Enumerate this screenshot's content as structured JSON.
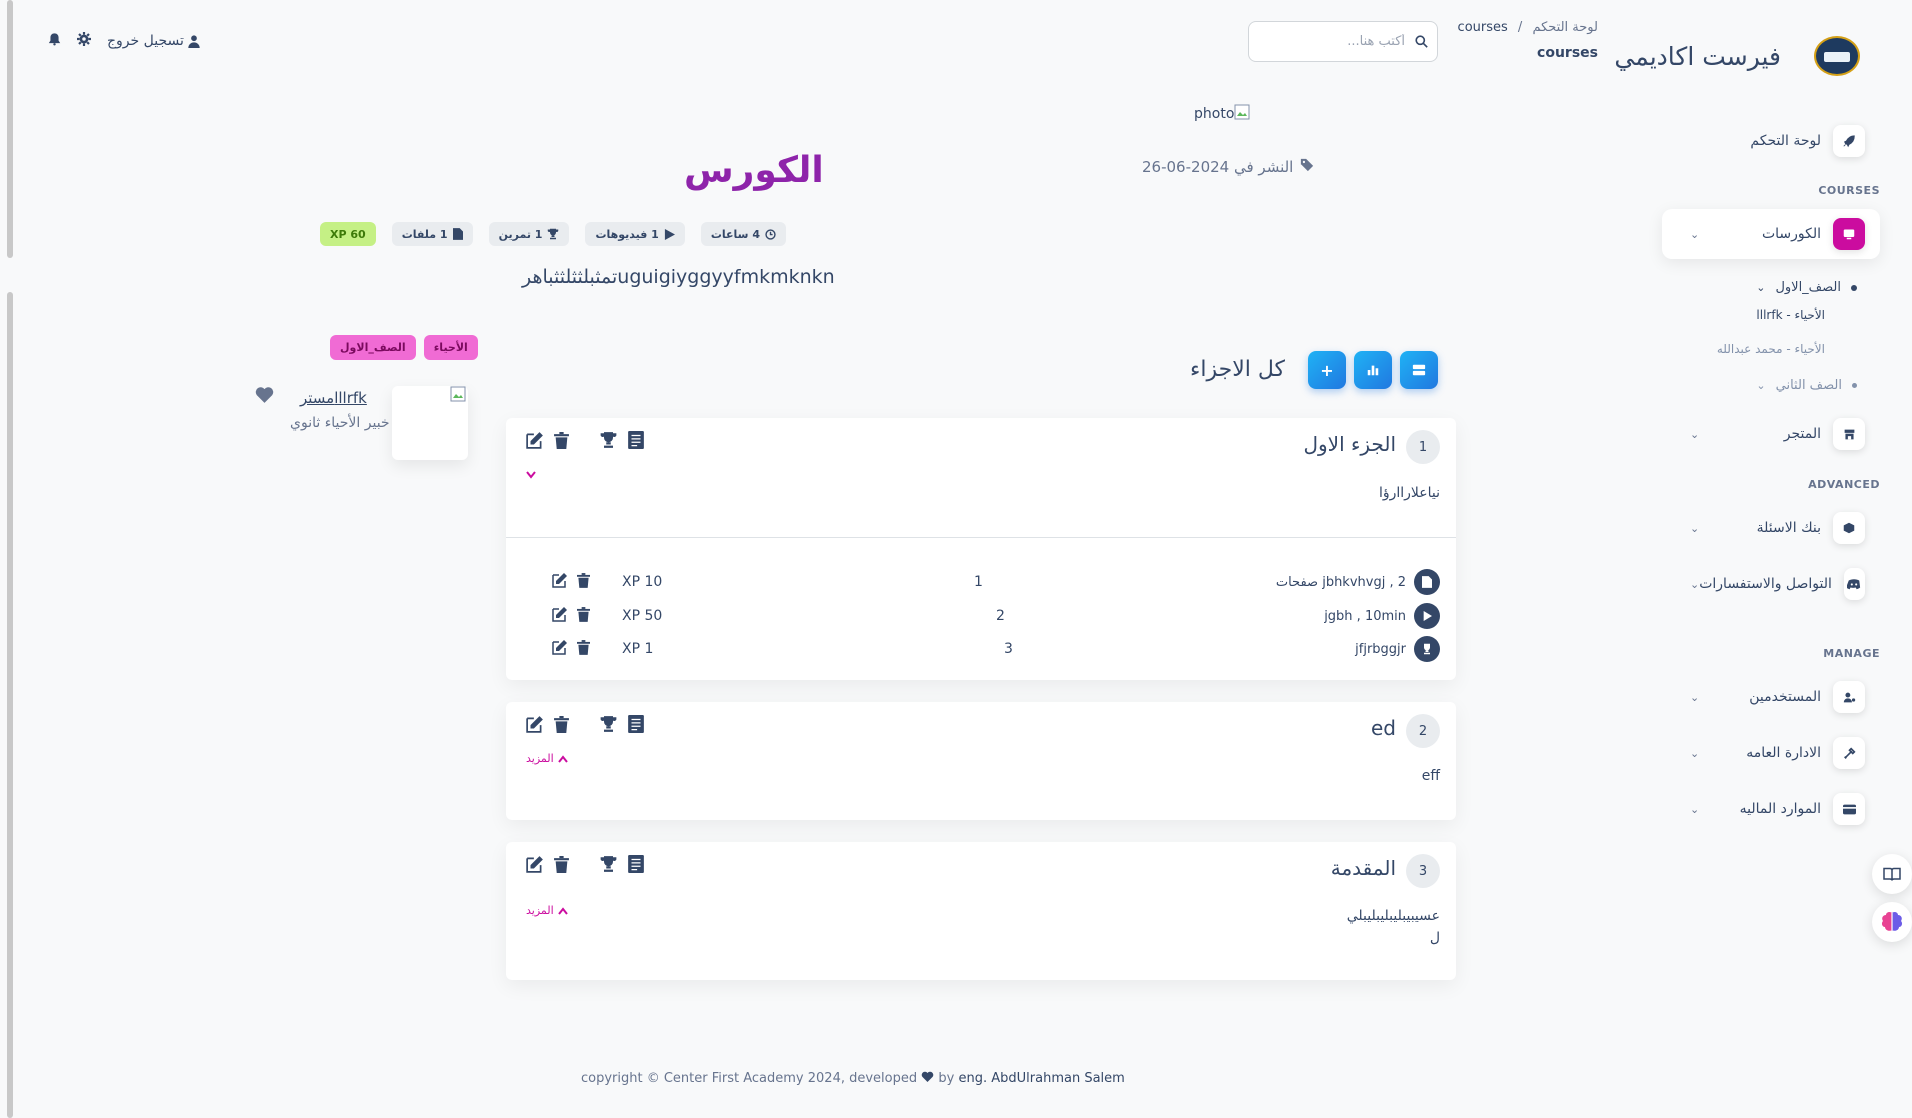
{
  "brand": {
    "name": "فيرست اكاديمي"
  },
  "header": {
    "breadcrumb_home": "لوحة التحكم",
    "breadcrumb_sep": "/",
    "breadcrumb_current": "courses",
    "page_title": "courses",
    "search_placeholder": "أكتب هنا...",
    "logout_label": "تسجيل خروج"
  },
  "sidebar": {
    "dashboard": "لوحة التحكم",
    "section_courses": "COURSES",
    "courses": "الكورسات",
    "grade1": "الصف_الاول",
    "grade1_sub1": "الأحياء - lllrfk",
    "grade1_sub2": "الأحياء - محمد عبدالله",
    "grade2": "الصف الثاني",
    "store": "المتجر",
    "section_advanced": "ADVANCED",
    "question_bank": "بنك الاسئلة",
    "communication": "التواصل والاستفسارات",
    "section_manage": "MANAGE",
    "users": "المستخدمين",
    "general_admin": "الادارة العامه",
    "finance": "الموارد الماليه"
  },
  "course": {
    "photo_alt": "photo",
    "published": "النشر في 2024-06-26",
    "title": "الكورس",
    "badge_hours": "4 ساعات",
    "badge_videos": "1 فيديوهات",
    "badge_exercises": "1 تمرين",
    "badge_files": "1 ملفات",
    "badge_xp": "XP 60",
    "description": "تمثبلثثلثثباهرuguigiyggyyfmkmknkn"
  },
  "teacher": {
    "name": "مسترlllrfk",
    "subtitle": "خبير الأحياء ثانوي",
    "tag_subject": "الأحياء",
    "tag_grade": "الصف_الاول"
  },
  "parts_header": {
    "title": "كل الاجزاء"
  },
  "parts": [
    {
      "number": "1",
      "title": "الجزء الاول",
      "description": "نياعلاراارؤا",
      "items": [
        {
          "name": "jbhkvhvgj , 2 صفحات",
          "order": "1",
          "xp": "XP 10"
        },
        {
          "name": "jgbh , 10min",
          "order": "2",
          "xp": "XP 50"
        },
        {
          "name": "jfjrbggjr",
          "order": "3",
          "xp": "XP 1"
        }
      ]
    },
    {
      "number": "2",
      "title": "ed",
      "description": "eff",
      "more": "المزيد"
    },
    {
      "number": "3",
      "title": "المقدمة",
      "description": "عسيبيبليبليبليبلي",
      "description2": "ل",
      "more": "المزيد"
    }
  ],
  "footer": {
    "text": "copyright © Center First Academy 2024, developed",
    "by": "by",
    "author": "eng. AbdUlrahman Salem"
  },
  "colors": {
    "accent": "#cb0c9f",
    "title_purple": "#8e24aa",
    "blue": "#1f8ef1",
    "text": "#344767"
  }
}
